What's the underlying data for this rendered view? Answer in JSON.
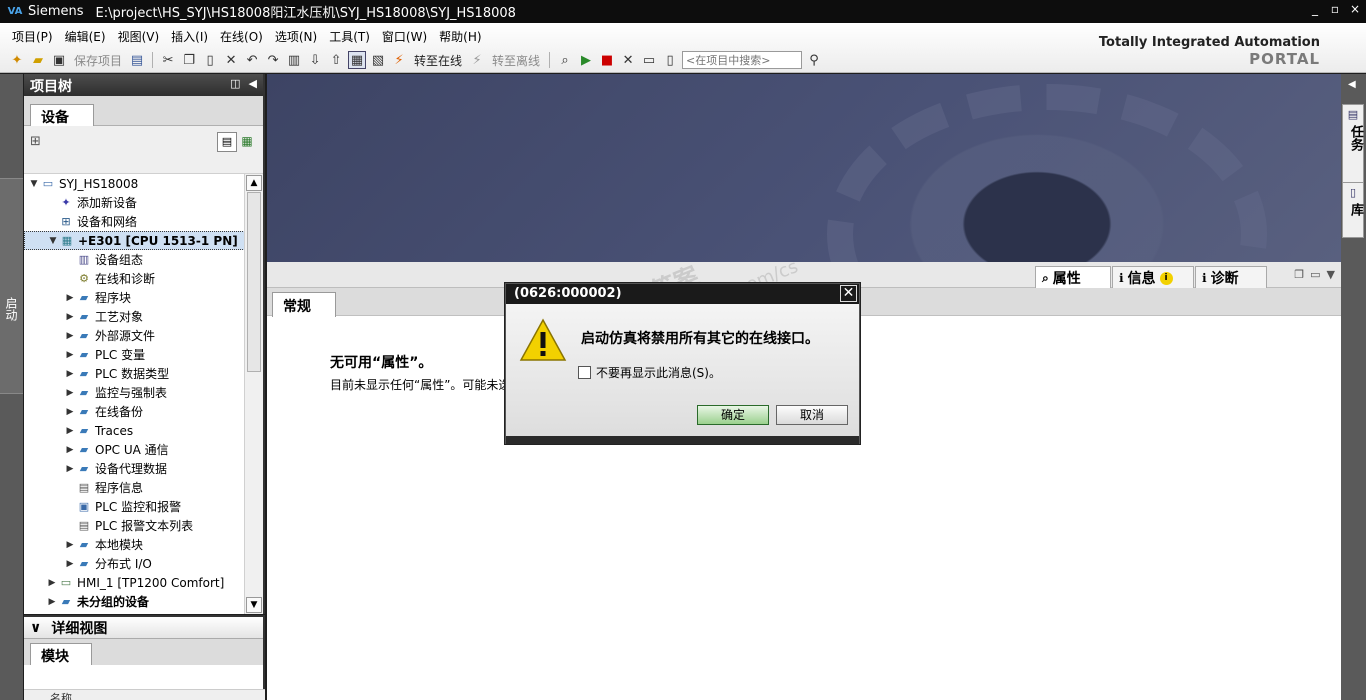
{
  "window": {
    "app": "Siemens",
    "title": "E:\\project\\HS_SYJ\\HS18008阳江水压机\\SYJ_HS18008\\SYJ_HS18008",
    "logo": "VA",
    "controls": [
      "_",
      "▫",
      "×"
    ]
  },
  "menu": [
    "项目(P)",
    "编辑(E)",
    "视图(V)",
    "插入(I)",
    "在线(O)",
    "选项(N)",
    "工具(T)",
    "窗口(W)",
    "帮助(H)"
  ],
  "toolbar": {
    "save_label": "保存项目",
    "go_online_label": "转至在线",
    "go_offline_label": "转至离线",
    "search_placeholder": "<在项目中搜索>"
  },
  "branding": {
    "line1": "Totally Integrated Automation",
    "line2": "PORTAL"
  },
  "left_strip": {
    "label": "启动"
  },
  "project_tree": {
    "title": "项目树",
    "tab": "设备",
    "items": [
      {
        "label": "SYJ_HS18008",
        "level": 0,
        "arrow": "▼",
        "icon": "project-icon"
      },
      {
        "label": "添加新设备",
        "level": 1,
        "arrow": "",
        "icon": "add-device-icon"
      },
      {
        "label": "设备和网络",
        "level": 1,
        "arrow": "",
        "icon": "network-icon"
      },
      {
        "label": "+E301 [CPU 1513-1 PN]",
        "level": 1,
        "arrow": "▼",
        "icon": "cpu-icon",
        "selected": true
      },
      {
        "label": "设备组态",
        "level": 2,
        "arrow": "",
        "icon": "device-config-icon"
      },
      {
        "label": "在线和诊断",
        "level": 2,
        "arrow": "",
        "icon": "diagnostics-icon"
      },
      {
        "label": "程序块",
        "level": 2,
        "arrow": "▶",
        "icon": "folder-icon"
      },
      {
        "label": "工艺对象",
        "level": 2,
        "arrow": "▶",
        "icon": "folder-icon"
      },
      {
        "label": "外部源文件",
        "level": 2,
        "arrow": "▶",
        "icon": "folder-icon"
      },
      {
        "label": "PLC 变量",
        "level": 2,
        "arrow": "▶",
        "icon": "folder-icon"
      },
      {
        "label": "PLC 数据类型",
        "level": 2,
        "arrow": "▶",
        "icon": "folder-icon"
      },
      {
        "label": "监控与强制表",
        "level": 2,
        "arrow": "▶",
        "icon": "folder-icon"
      },
      {
        "label": "在线备份",
        "level": 2,
        "arrow": "▶",
        "icon": "folder-icon"
      },
      {
        "label": "Traces",
        "level": 2,
        "arrow": "▶",
        "icon": "folder-icon"
      },
      {
        "label": "OPC UA 通信",
        "level": 2,
        "arrow": "▶",
        "icon": "folder-icon"
      },
      {
        "label": "设备代理数据",
        "level": 2,
        "arrow": "▶",
        "icon": "folder-icon"
      },
      {
        "label": "程序信息",
        "level": 2,
        "arrow": "",
        "icon": "doc-icon"
      },
      {
        "label": "PLC 监控和报警",
        "level": 2,
        "arrow": "",
        "icon": "alarm-icon"
      },
      {
        "label": "PLC 报警文本列表",
        "level": 2,
        "arrow": "",
        "icon": "doc-icon"
      },
      {
        "label": "本地模块",
        "level": 2,
        "arrow": "▶",
        "icon": "folder-icon"
      },
      {
        "label": "分布式 I/O",
        "level": 2,
        "arrow": "▶",
        "icon": "folder-icon"
      },
      {
        "label": "HMI_1 [TP1200 Comfort]",
        "level": 1,
        "arrow": "▶",
        "icon": "hmi-icon"
      },
      {
        "label": "未分组的设备",
        "level": 1,
        "arrow": "▶",
        "icon": "folder-icon",
        "bold": true
      }
    ]
  },
  "detail_view": {
    "title": "详细视图",
    "tab": "模块",
    "column": "名称"
  },
  "inspector": {
    "tabs": [
      "属性",
      "信息",
      "诊断"
    ],
    "subtab": "常规",
    "msg_title": "无可用“属性”。",
    "msg_body": "目前未显示任何“属性”。可能未选"
  },
  "right_strip": {
    "tabs": [
      "任务",
      "库"
    ]
  },
  "watermark": {
    "line1": "西门子工业 找答案",
    "line2": "support.industry.siemens.com/cs"
  },
  "dialog": {
    "title": "(0626:000002)",
    "message": "启动仿真将禁用所有其它的在线接口。",
    "checkbox_label": "不要再显示此消息(S)。",
    "ok_label": "确定",
    "cancel_label": "取消"
  },
  "colors": {
    "titlebar": "#0d0d0d",
    "banner": "#4a5276",
    "selection": "#cfe0f3",
    "ok_button": "#9bd18e",
    "warning": "#f2d100"
  }
}
